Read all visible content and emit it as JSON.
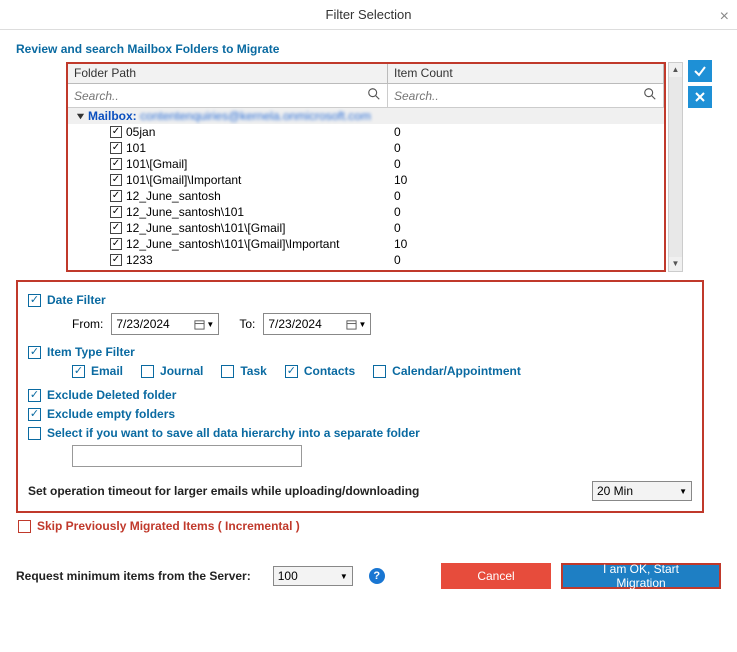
{
  "window": {
    "title": "Filter Selection"
  },
  "heading": "Review and search Mailbox Folders to Migrate",
  "columns": {
    "path": "Folder Path",
    "count": "Item Count"
  },
  "search_placeholder": "Search..",
  "mailbox": {
    "prefix": "Mailbox:",
    "email": "contentenquiries@kernela.onmicrosoft.com"
  },
  "folders": [
    {
      "name": "05jan",
      "count": "0"
    },
    {
      "name": "101",
      "count": "0"
    },
    {
      "name": "101\\[Gmail]",
      "count": "0"
    },
    {
      "name": "101\\[Gmail]\\Important",
      "count": "10"
    },
    {
      "name": "12_June_santosh",
      "count": "0"
    },
    {
      "name": "12_June_santosh\\101",
      "count": "0"
    },
    {
      "name": "12_June_santosh\\101\\[Gmail]",
      "count": "0"
    },
    {
      "name": "12_June_santosh\\101\\[Gmail]\\Important",
      "count": "10"
    },
    {
      "name": "1233",
      "count": "0"
    }
  ],
  "filters": {
    "date_filter_label": "Date Filter",
    "from_label": "From:",
    "to_label": "To:",
    "from_value": "7/23/2024",
    "to_value": "7/23/2024",
    "item_type_label": "Item Type Filter",
    "types": {
      "email": "Email",
      "journal": "Journal",
      "task": "Task",
      "contacts": "Contacts",
      "calendar": "Calendar/Appointment"
    },
    "exclude_deleted": "Exclude Deleted folder",
    "exclude_empty": "Exclude empty folders",
    "save_hierarchy": "Select if you want to save all data hierarchy into a separate folder",
    "timeout_label": "Set operation timeout for larger emails while uploading/downloading",
    "timeout_value": "20 Min"
  },
  "skip_label": "Skip Previously Migrated Items ( Incremental )",
  "request_label": "Request minimum items from the Server:",
  "request_value": "100",
  "buttons": {
    "cancel": "Cancel",
    "start": "I am OK, Start Migration"
  }
}
